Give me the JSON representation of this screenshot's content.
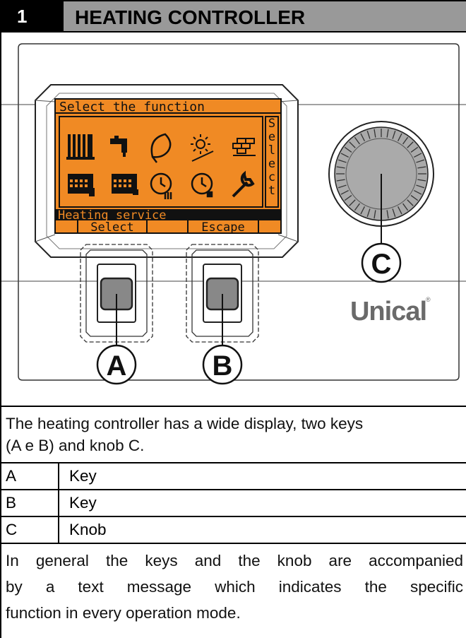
{
  "header": {
    "number": "1",
    "title": "HEATING CONTROLLER"
  },
  "display": {
    "top_text": "Select the function",
    "side_text": "Select",
    "status_text": "Heating service",
    "soft_keys": [
      "Select",
      "Escape"
    ],
    "background_color": "#f08a24"
  },
  "callouts": {
    "a": "A",
    "b": "B",
    "c": "C"
  },
  "brand": "Unical",
  "brand_mark": "®",
  "intro": [
    "The heating controller has a wide display, two keys",
    "(A e B) and knob C."
  ],
  "legend": [
    {
      "key": "A",
      "desc": "Key"
    },
    {
      "key": "B",
      "desc": "Key"
    },
    {
      "key": "C",
      "desc": "Knob"
    }
  ],
  "note": [
    "In general the keys and the knob are accompanied",
    "by a text message which indicates the specific",
    "function in every operation mode."
  ]
}
